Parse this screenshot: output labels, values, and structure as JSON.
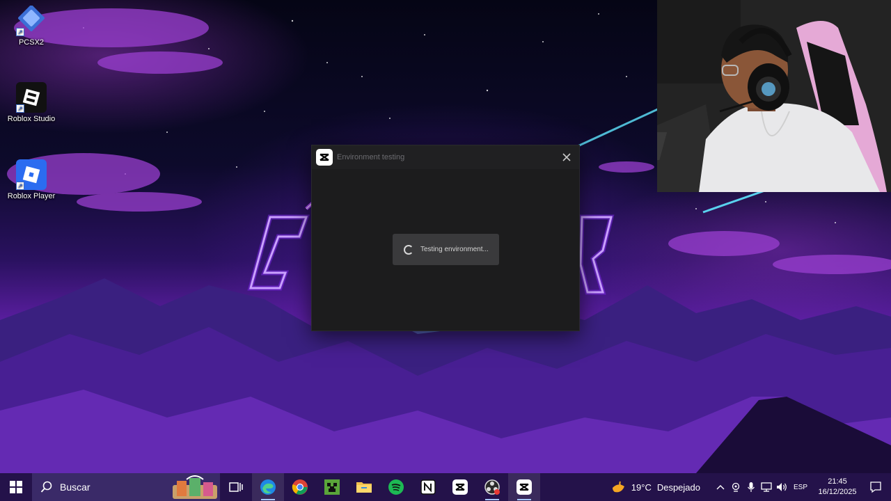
{
  "desktop": {
    "icons": [
      {
        "label": "PCSX2",
        "icon": "pcsx2-icon"
      },
      {
        "label": "Roblox Studio",
        "icon": "roblox-studio-icon"
      },
      {
        "label": "Roblox Player",
        "icon": "roblox-player-icon"
      }
    ]
  },
  "dialog": {
    "title": "Environment testing",
    "status": "Testing environment..."
  },
  "taskbar": {
    "search_label": "Buscar",
    "apps": [
      "task-view",
      "edge",
      "chrome",
      "minecraft",
      "file-explorer",
      "spotify",
      "notion",
      "capcut",
      "obs",
      "capcut"
    ],
    "weather": {
      "temp": "19°C",
      "desc": "Despejado"
    },
    "language": "ESP",
    "time": "21:45",
    "date": "16/12/2025"
  },
  "colors": {
    "taskbar_bg": "#24124a",
    "dialog_bg": "#1c1c1d",
    "status_box": "#3a3a3c"
  }
}
